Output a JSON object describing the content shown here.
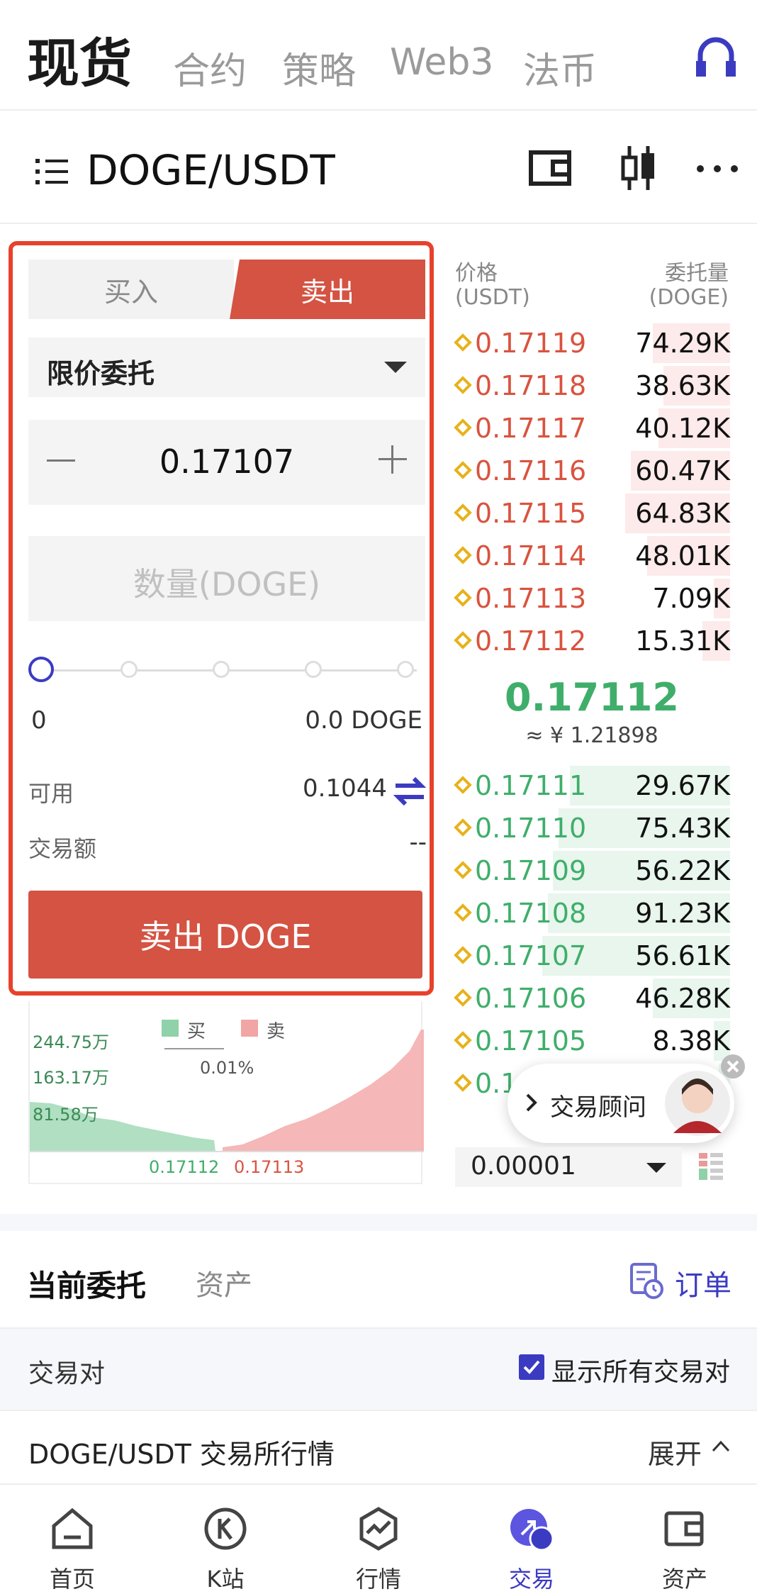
{
  "top_tabs": {
    "active": "现货",
    "others": [
      "合约",
      "策略",
      "Web3",
      "法币"
    ]
  },
  "pair": {
    "title": "DOGE/USDT"
  },
  "form": {
    "buy_label": "买入",
    "sell_label": "卖出",
    "order_type": "限价委托",
    "price_value": "0.17107",
    "qty_placeholder": "数量(DOGE)",
    "slider_min": "0",
    "slider_max": "0.0 DOGE",
    "available_label": "可用",
    "available_value": "0.1044",
    "amount_label": "交易额",
    "amount_value": "--",
    "submit_label": "卖出 DOGE"
  },
  "orderbook": {
    "price_header": "价格",
    "price_unit": "(USDT)",
    "qty_header": "委托量",
    "qty_unit": "(DOGE)",
    "asks": [
      {
        "price": "0.17119",
        "qty": "74.29K",
        "depth": 0.28
      },
      {
        "price": "0.17118",
        "qty": "38.63K",
        "depth": 0.24
      },
      {
        "price": "0.17117",
        "qty": "40.12K",
        "depth": 0.26
      },
      {
        "price": "0.17116",
        "qty": "60.47K",
        "depth": 0.36
      },
      {
        "price": "0.17115",
        "qty": "64.83K",
        "depth": 0.38
      },
      {
        "price": "0.17114",
        "qty": "48.01K",
        "depth": 0.3
      },
      {
        "price": "0.17113",
        "qty": "7.09K",
        "depth": 0.06
      },
      {
        "price": "0.17112",
        "qty": "15.31K",
        "depth": 0.1
      }
    ],
    "last_price": "0.17112",
    "last_price_cny": "≈ ¥ 1.21898",
    "bids": [
      {
        "price": "0.17111",
        "qty": "29.67K",
        "depth": 0.58
      },
      {
        "price": "0.17110",
        "qty": "75.43K",
        "depth": 0.62
      },
      {
        "price": "0.17109",
        "qty": "56.22K",
        "depth": 0.64
      },
      {
        "price": "0.17108",
        "qty": "91.23K",
        "depth": 0.66
      },
      {
        "price": "0.17107",
        "qty": "56.61K",
        "depth": 0.68
      },
      {
        "price": "0.17106",
        "qty": "46.28K",
        "depth": 0.28
      },
      {
        "price": "0.17105",
        "qty": "8.38K",
        "depth": 0.06
      },
      {
        "price": "0.1",
        "qty": "",
        "depth": 0.04
      }
    ],
    "tick_size": "0.00001"
  },
  "depth_chart": {
    "y_labels": [
      "244.75万",
      "163.17万",
      "81.58万"
    ],
    "legend_buy": "买",
    "legend_sell": "卖",
    "spread": "0.01%",
    "bid_price": "0.17112",
    "ask_price": "0.17113",
    "buy_color": "#8fd1a8",
    "sell_color": "#f2a5a5"
  },
  "advisor": {
    "label": "交易顾问"
  },
  "orders": {
    "tab_active": "当前委托",
    "tab_other": "资产",
    "orders_link": "订单",
    "pair_label": "交易对",
    "show_all": "显示所有交易对",
    "market_row": "DOGE/USDT 交易所行情",
    "expand": "展开"
  },
  "nav": [
    "首页",
    "K站",
    "行情",
    "交易",
    "资产"
  ],
  "colors": {
    "accent": "#3b3bc2",
    "sell": "#d45343",
    "buy": "#3fae6a"
  }
}
